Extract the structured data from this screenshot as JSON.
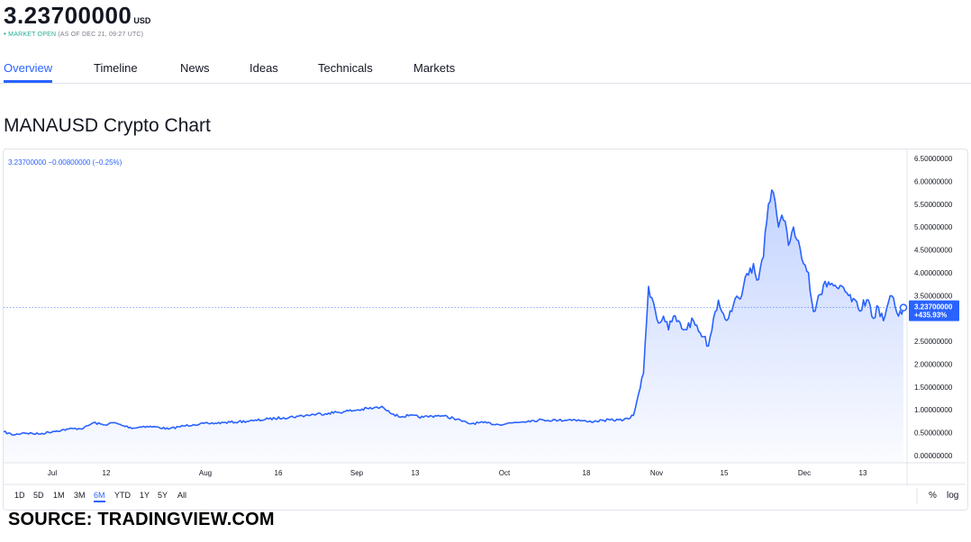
{
  "header": {
    "price": "3.23700000",
    "currency": "USD",
    "status_dot": "•",
    "market_status": "MARKET OPEN",
    "as_of": "(AS OF DEC 21, 09:27 UTC)"
  },
  "tabs": [
    {
      "label": "Overview",
      "active": true
    },
    {
      "label": "Timeline",
      "active": false
    },
    {
      "label": "News",
      "active": false
    },
    {
      "label": "Ideas",
      "active": false
    },
    {
      "label": "Technicals",
      "active": false
    },
    {
      "label": "Markets",
      "active": false
    }
  ],
  "chart_title": "MANAUSD Crypto Chart",
  "legend_text": "3.23700000 −0.00800000 (−0.25%)",
  "range_buttons": [
    {
      "label": "1D",
      "active": false
    },
    {
      "label": "5D",
      "active": false
    },
    {
      "label": "1M",
      "active": false
    },
    {
      "label": "3M",
      "active": false
    },
    {
      "label": "6M",
      "active": true
    },
    {
      "label": "YTD",
      "active": false
    },
    {
      "label": "1Y",
      "active": false
    },
    {
      "label": "5Y",
      "active": false
    },
    {
      "label": "All",
      "active": false
    }
  ],
  "tools": {
    "percent": "%",
    "log": "log"
  },
  "source": "SOURCE: TRADINGVIEW.COM",
  "colors": {
    "accent": "#2962ff",
    "line": "#2962ff",
    "market_open": "#22ab94",
    "grid": "#e0e3eb"
  },
  "chart_data": {
    "type": "area",
    "title": "MANAUSD Crypto Chart",
    "series": [
      {
        "name": "MANAUSD",
        "color": "#2962ff"
      }
    ],
    "x_tick_labels": [
      "Jul",
      "12",
      "Aug",
      "16",
      "Sep",
      "13",
      "Oct",
      "18",
      "Nov",
      "15",
      "Dec",
      "13"
    ],
    "y_ticks": [
      "6.50000000",
      "6.00000000",
      "5.50000000",
      "5.00000000",
      "4.50000000",
      "4.00000000",
      "3.50000000",
      "3.00000000",
      "2.50000000",
      "2.00000000",
      "1.50000000",
      "1.00000000",
      "0.50000000",
      "0.00000000"
    ],
    "ylim": [
      0,
      6.5
    ],
    "x_axis": "dates from Jun 2021 to Dec 21 2021",
    "points": [
      [
        "2021-06-24",
        0.52
      ],
      [
        "2021-06-26",
        0.45
      ],
      [
        "2021-06-28",
        0.5
      ],
      [
        "2021-07-01",
        0.47
      ],
      [
        "2021-07-04",
        0.53
      ],
      [
        "2021-07-07",
        0.58
      ],
      [
        "2021-07-10",
        0.6
      ],
      [
        "2021-07-12",
        0.72
      ],
      [
        "2021-07-14",
        0.67
      ],
      [
        "2021-07-16",
        0.72
      ],
      [
        "2021-07-18",
        0.65
      ],
      [
        "2021-07-20",
        0.6
      ],
      [
        "2021-07-22",
        0.64
      ],
      [
        "2021-07-25",
        0.62
      ],
      [
        "2021-07-27",
        0.58
      ],
      [
        "2021-07-29",
        0.63
      ],
      [
        "2021-08-01",
        0.68
      ],
      [
        "2021-08-04",
        0.7
      ],
      [
        "2021-08-07",
        0.72
      ],
      [
        "2021-08-10",
        0.74
      ],
      [
        "2021-08-13",
        0.76
      ],
      [
        "2021-08-16",
        0.8
      ],
      [
        "2021-08-19",
        0.83
      ],
      [
        "2021-08-22",
        0.86
      ],
      [
        "2021-08-25",
        0.9
      ],
      [
        "2021-08-28",
        0.93
      ],
      [
        "2021-08-31",
        0.96
      ],
      [
        "2021-09-03",
        1.0
      ],
      [
        "2021-09-06",
        1.04
      ],
      [
        "2021-09-08",
        1.05
      ],
      [
        "2021-09-09",
        0.98
      ],
      [
        "2021-09-11",
        0.85
      ],
      [
        "2021-09-13",
        0.87
      ],
      [
        "2021-09-16",
        0.84
      ],
      [
        "2021-09-19",
        0.88
      ],
      [
        "2021-09-22",
        0.82
      ],
      [
        "2021-09-25",
        0.7
      ],
      [
        "2021-09-28",
        0.72
      ],
      [
        "2021-10-01",
        0.68
      ],
      [
        "2021-10-04",
        0.72
      ],
      [
        "2021-10-07",
        0.76
      ],
      [
        "2021-10-10",
        0.78
      ],
      [
        "2021-10-13",
        0.77
      ],
      [
        "2021-10-16",
        0.79
      ],
      [
        "2021-10-19",
        0.74
      ],
      [
        "2021-10-22",
        0.77
      ],
      [
        "2021-10-25",
        0.78
      ],
      [
        "2021-10-27",
        0.8
      ],
      [
        "2021-10-28",
        0.88
      ],
      [
        "2021-10-29",
        1.35
      ],
      [
        "2021-10-30",
        1.8
      ],
      [
        "2021-10-31",
        3.7
      ],
      [
        "2021-11-01",
        3.35
      ],
      [
        "2021-11-02",
        2.9
      ],
      [
        "2021-11-03",
        3.05
      ],
      [
        "2021-11-04",
        2.75
      ],
      [
        "2021-11-05",
        3.05
      ],
      [
        "2021-11-07",
        2.75
      ],
      [
        "2021-11-09",
        2.95
      ],
      [
        "2021-11-11",
        2.6
      ],
      [
        "2021-11-12",
        2.4
      ],
      [
        "2021-11-13",
        3.0
      ],
      [
        "2021-11-14",
        3.4
      ],
      [
        "2021-11-15",
        3.1
      ],
      [
        "2021-11-16",
        3.0
      ],
      [
        "2021-11-17",
        3.3
      ],
      [
        "2021-11-18",
        3.45
      ],
      [
        "2021-11-19",
        3.7
      ],
      [
        "2021-11-20",
        3.95
      ],
      [
        "2021-11-21",
        4.2
      ],
      [
        "2021-11-22",
        3.85
      ],
      [
        "2021-11-23",
        4.35
      ],
      [
        "2021-11-24",
        5.5
      ],
      [
        "2021-11-25",
        5.75
      ],
      [
        "2021-11-26",
        5.0
      ],
      [
        "2021-11-27",
        5.15
      ],
      [
        "2021-11-28",
        4.6
      ],
      [
        "2021-11-29",
        5.0
      ],
      [
        "2021-11-30",
        4.7
      ],
      [
        "2021-12-01",
        4.2
      ],
      [
        "2021-12-02",
        4.0
      ],
      [
        "2021-12-03",
        3.15
      ],
      [
        "2021-12-04",
        3.5
      ],
      [
        "2021-12-06",
        3.8
      ],
      [
        "2021-12-08",
        3.65
      ],
      [
        "2021-12-10",
        3.5
      ],
      [
        "2021-12-12",
        3.2
      ],
      [
        "2021-12-14",
        3.4
      ],
      [
        "2021-12-15",
        3.0
      ],
      [
        "2021-12-16",
        3.25
      ],
      [
        "2021-12-17",
        2.95
      ],
      [
        "2021-12-18",
        3.35
      ],
      [
        "2021-12-19",
        3.45
      ],
      [
        "2021-12-20",
        3.05
      ],
      [
        "2021-12-21",
        3.237
      ]
    ],
    "last_value_label": "3.23700000",
    "last_change_label": "+435.93%",
    "reference_line": 3.237
  }
}
